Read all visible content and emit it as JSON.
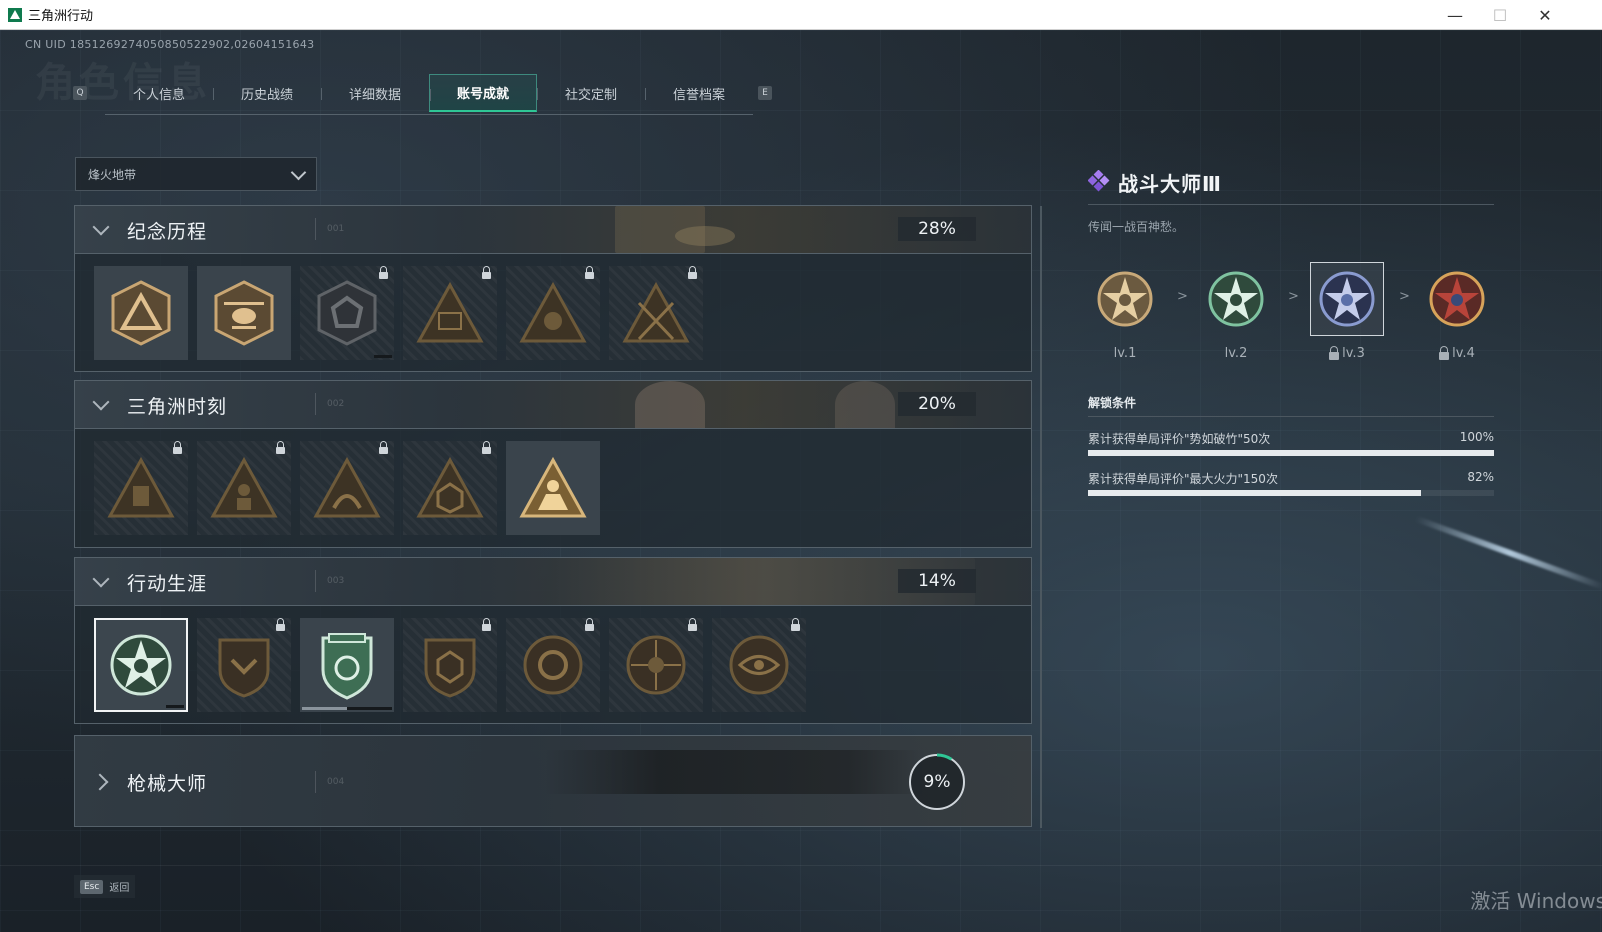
{
  "window": {
    "title": "三角洲行动",
    "minimize": "—",
    "maximize": "☐",
    "close": "✕"
  },
  "header": {
    "uid": "CN UID 1851269274050850522902,02604151643",
    "ghost_title": "角色信息"
  },
  "tabs": {
    "key_left": "Q",
    "key_right": "E",
    "items": [
      {
        "label": "个人信息",
        "active": false
      },
      {
        "label": "历史战绩",
        "active": false
      },
      {
        "label": "详细数据",
        "active": false
      },
      {
        "label": "账号成就",
        "active": true
      },
      {
        "label": "社交定制",
        "active": false
      },
      {
        "label": "信誉档案",
        "active": false
      }
    ]
  },
  "mode_select": {
    "value": "烽火地带"
  },
  "sections": [
    {
      "title": "纪念历程",
      "code": "001",
      "percent": "28%",
      "expanded": true,
      "badges": [
        {
          "icon": "delta-logo-badge-icon",
          "locked": false
        },
        {
          "icon": "helicopter-badge-icon",
          "locked": false
        },
        {
          "icon": "shield-emblem-badge-icon",
          "locked": true
        },
        {
          "icon": "sb-triangle-badge-icon",
          "locked": true
        },
        {
          "icon": "skull-triangle-badge-icon",
          "locked": true
        },
        {
          "icon": "crossed-blades-badge-icon",
          "locked": true
        }
      ]
    },
    {
      "title": "三角洲时刻",
      "code": "002",
      "percent": "20%",
      "expanded": true,
      "badges": [
        {
          "icon": "robot-triangle-badge-icon",
          "locked": true
        },
        {
          "icon": "soldier-triangle-badge-icon",
          "locked": true
        },
        {
          "icon": "runner-triangle-badge-icon",
          "locked": true
        },
        {
          "icon": "cube-triangle-badge-icon",
          "locked": true
        },
        {
          "icon": "squad-triangle-badge-icon",
          "locked": false
        }
      ]
    },
    {
      "title": "行动生涯",
      "code": "003",
      "percent": "14%",
      "expanded": true,
      "badges": [
        {
          "icon": "green-star-badge-icon",
          "locked": false,
          "selected": true
        },
        {
          "icon": "chevron-shield-badge-icon",
          "locked": true
        },
        {
          "icon": "green-shield-badge-icon",
          "locked": false
        },
        {
          "icon": "hexagon-badge-icon",
          "locked": true
        },
        {
          "icon": "ring-badge-icon",
          "locked": true
        },
        {
          "icon": "crosshair-skull-badge-icon",
          "locked": true
        },
        {
          "icon": "eye-badge-icon",
          "locked": true
        }
      ]
    },
    {
      "title": "枪械大师",
      "code": "004",
      "percent": "9%",
      "progress": 0.09,
      "expanded": false
    }
  ],
  "detail": {
    "title": "战斗大师Ⅲ",
    "description": "传闻一战百神愁。",
    "arrow": ">",
    "levels": [
      {
        "label": "lv.1",
        "locked": false,
        "color": "#c8a979"
      },
      {
        "label": "lv.2",
        "locked": false,
        "color": "#7fc3a0"
      },
      {
        "label": "lv.3",
        "locked": true,
        "selected": true,
        "color": "#5b6fa8"
      },
      {
        "label": "lv.4",
        "locked": true,
        "color": "#b8443a"
      }
    ],
    "unlock_title": "解锁条件",
    "conditions": [
      {
        "text": "累计获得单局评价\"势如破竹\"50次",
        "percent": "100%",
        "progress": 1.0
      },
      {
        "text": "累计获得单局评价\"最大火力\"150次",
        "percent": "82%",
        "progress": 0.82
      }
    ]
  },
  "footer": {
    "esc_key": "Esc",
    "back_label": "返回",
    "watermark": "激活 Windows"
  },
  "colors": {
    "accent": "#2fc796",
    "locked_badge": "#6d5a3a",
    "panel_border": "#55616a"
  }
}
